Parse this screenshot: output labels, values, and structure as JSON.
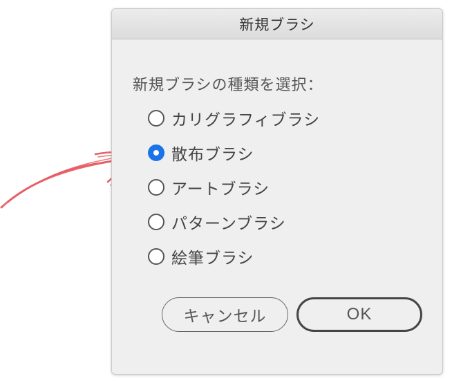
{
  "dialog": {
    "title": "新規ブラシ",
    "prompt": "新規ブラシの種類を選択：",
    "options": [
      {
        "label": "カリグラフィブラシ",
        "selected": false
      },
      {
        "label": "散布ブラシ",
        "selected": true
      },
      {
        "label": "アートブラシ",
        "selected": false
      },
      {
        "label": "パターンブラシ",
        "selected": false
      },
      {
        "label": "絵筆ブラシ",
        "selected": false
      }
    ],
    "buttons": {
      "cancel_label": "キャンセル",
      "ok_label": "OK"
    }
  },
  "annotation": {
    "arrow_color": "#e8636b",
    "points_to": "散布ブラシ"
  },
  "colors": {
    "accent": "#1a74e8",
    "dialog_background": "#efefef"
  }
}
